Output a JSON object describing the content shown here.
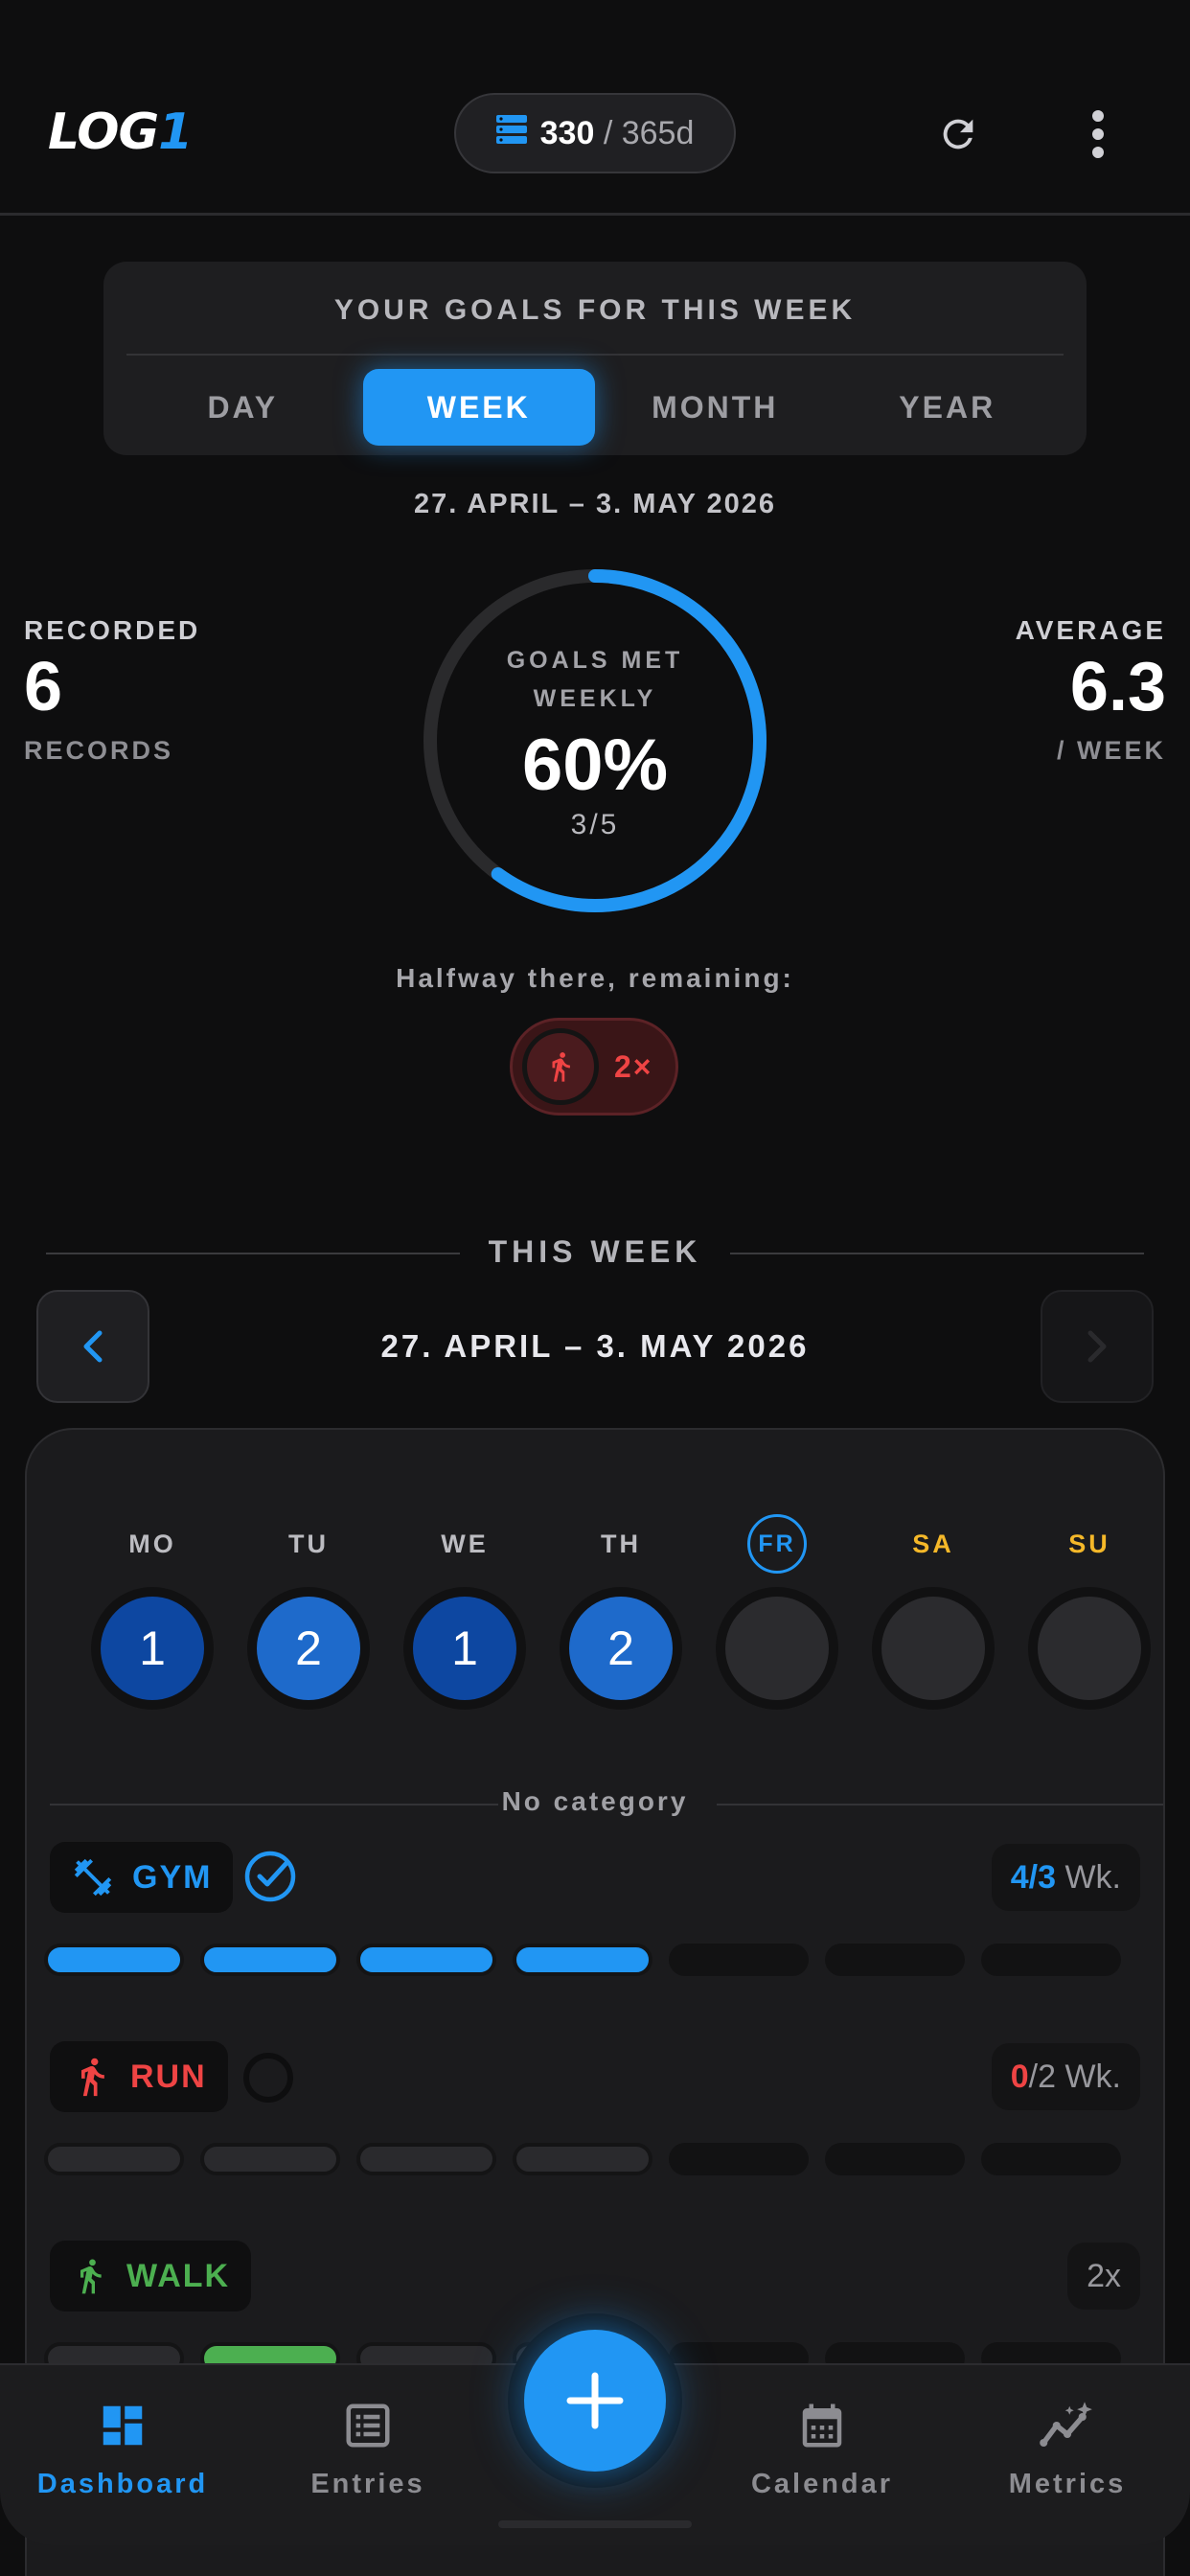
{
  "header": {
    "logo_main": "LOG",
    "logo_accent": "1",
    "quota_used": "330",
    "quota_sep": "/",
    "quota_total": "365d"
  },
  "goals": {
    "title": "YOUR GOALS FOR THIS WEEK",
    "tabs": [
      "DAY",
      "WEEK",
      "MONTH",
      "YEAR"
    ],
    "active_tab": "WEEK",
    "range": "27. APRIL – 3. MAY 2026"
  },
  "stats": {
    "recorded_label": "RECORDED",
    "recorded_value": "6",
    "recorded_sub": "RECORDS",
    "average_label": "AVERAGE",
    "average_value": "6.3",
    "average_sub": "/ WEEK"
  },
  "ring": {
    "label_line1": "GOALS MET",
    "label_line2": "WEEKLY",
    "percent_text": "60%",
    "fraction": "3/5",
    "progress": 0.6,
    "color": "#2196f3"
  },
  "remaining": {
    "text": "Halfway there, remaining:",
    "icon": "run-icon",
    "count": "2×"
  },
  "this_week": {
    "title": "THIS WEEK",
    "range": "27. APRIL – 3. MAY 2026",
    "days": [
      {
        "label": "MO",
        "count": "1",
        "color": "#0d47a1"
      },
      {
        "label": "TU",
        "count": "2",
        "color": "#1e6acb"
      },
      {
        "label": "WE",
        "count": "1",
        "color": "#0d47a1"
      },
      {
        "label": "TH",
        "count": "2",
        "color": "#1e6acb"
      },
      {
        "label": "FR",
        "count": "",
        "color": "",
        "today": true
      },
      {
        "label": "SA",
        "count": "",
        "color": "",
        "weekend": true
      },
      {
        "label": "SU",
        "count": "",
        "color": "",
        "weekend": true
      }
    ],
    "category": "No category",
    "habits": [
      {
        "name": "GYM",
        "icon": "dumbbell-icon",
        "color": "#2196f3",
        "done": "4",
        "sep": "/",
        "goal": "3",
        "unit": "Wk.",
        "bars": [
          "filled",
          "filled",
          "filled",
          "filled",
          "future",
          "future",
          "future"
        ]
      },
      {
        "name": "RUN",
        "icon": "run-icon",
        "color": "#ef4444",
        "done": "0",
        "sep": "/",
        "goal": "2",
        "unit": "Wk.",
        "bars": [
          "past",
          "past",
          "past",
          "past",
          "future",
          "future",
          "future"
        ]
      },
      {
        "name": "WALK",
        "icon": "walk-icon",
        "color": "#4caf50",
        "freq": "2x",
        "bars": [
          "past",
          "filled",
          "past",
          "past",
          "future",
          "future",
          "future"
        ]
      }
    ]
  },
  "bottom_nav": {
    "dashboard": "Dashboard",
    "entries": "Entries",
    "calendar": "Calendar",
    "metrics": "Metrics",
    "active": "Dashboard"
  }
}
